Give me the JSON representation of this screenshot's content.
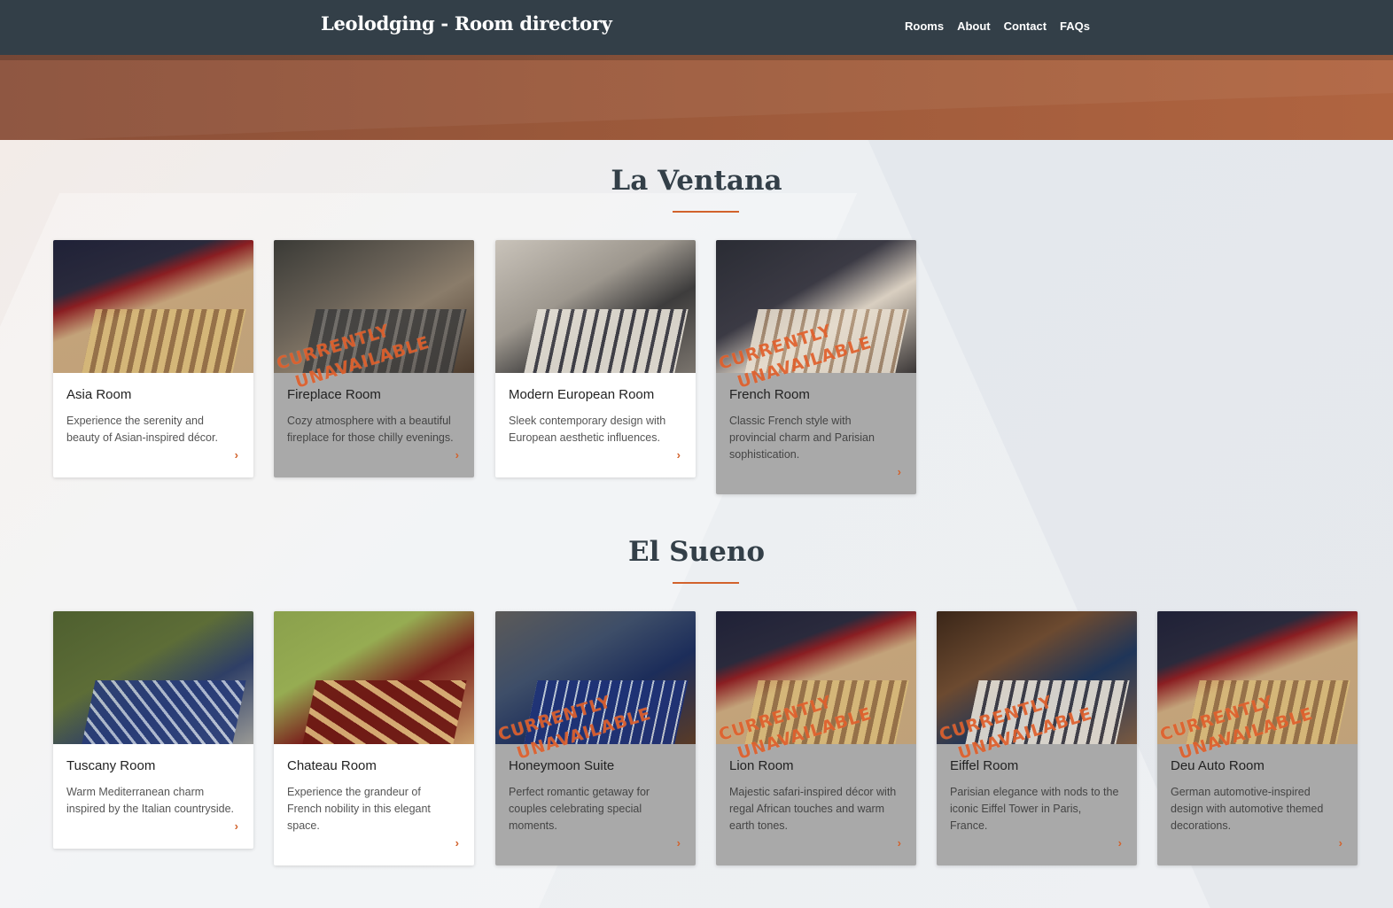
{
  "header": {
    "site_title": "Leolodging - Room directory",
    "nav": [
      "Rooms",
      "About",
      "Contact",
      "FAQs"
    ]
  },
  "colors": {
    "header_bg": "#333f48",
    "accent": "#d2622c",
    "hero": "#9d5a3b",
    "unavailable_card": "#a9a9a9"
  },
  "unavailable_stamp": [
    "CURRENTLY",
    "UNAVAILABLE"
  ],
  "arrow_icon": "chevron-right-icon",
  "sections": [
    {
      "title": "La Ventana",
      "rooms": [
        {
          "title": "Asia Room",
          "desc": "Experience the serenity and beauty of Asian-inspired décor.",
          "unavailable": false
        },
        {
          "title": "Fireplace Room",
          "desc": "Cozy atmosphere with a beautiful fireplace for those chilly evenings.",
          "unavailable": true
        },
        {
          "title": "Modern European Room",
          "desc": "Sleek contemporary design with European aesthetic influences.",
          "unavailable": false
        },
        {
          "title": "French Room",
          "desc": "Classic French style with provincial charm and Parisian sophistication.",
          "unavailable": true
        }
      ]
    },
    {
      "title": "El Sueno",
      "rooms": [
        {
          "title": "Tuscany Room",
          "desc": "Warm Mediterranean charm inspired by the Italian countryside.",
          "unavailable": false
        },
        {
          "title": "Chateau Room",
          "desc": "Experience the grandeur of French nobility in this elegant space.",
          "unavailable": false
        },
        {
          "title": "Honeymoon Suite",
          "desc": "Perfect romantic getaway for couples celebrating special moments.",
          "unavailable": true
        },
        {
          "title": "Lion Room",
          "desc": "Majestic safari-inspired décor with regal African touches and warm earth tones.",
          "unavailable": true
        },
        {
          "title": "Eiffel Room",
          "desc": "Parisian elegance with nods to the iconic Eiffel Tower in Paris, France.",
          "unavailable": true
        },
        {
          "title": "Deu Auto Room",
          "desc": "German automotive-inspired design with automotive themed decorations.",
          "unavailable": true
        }
      ]
    }
  ]
}
